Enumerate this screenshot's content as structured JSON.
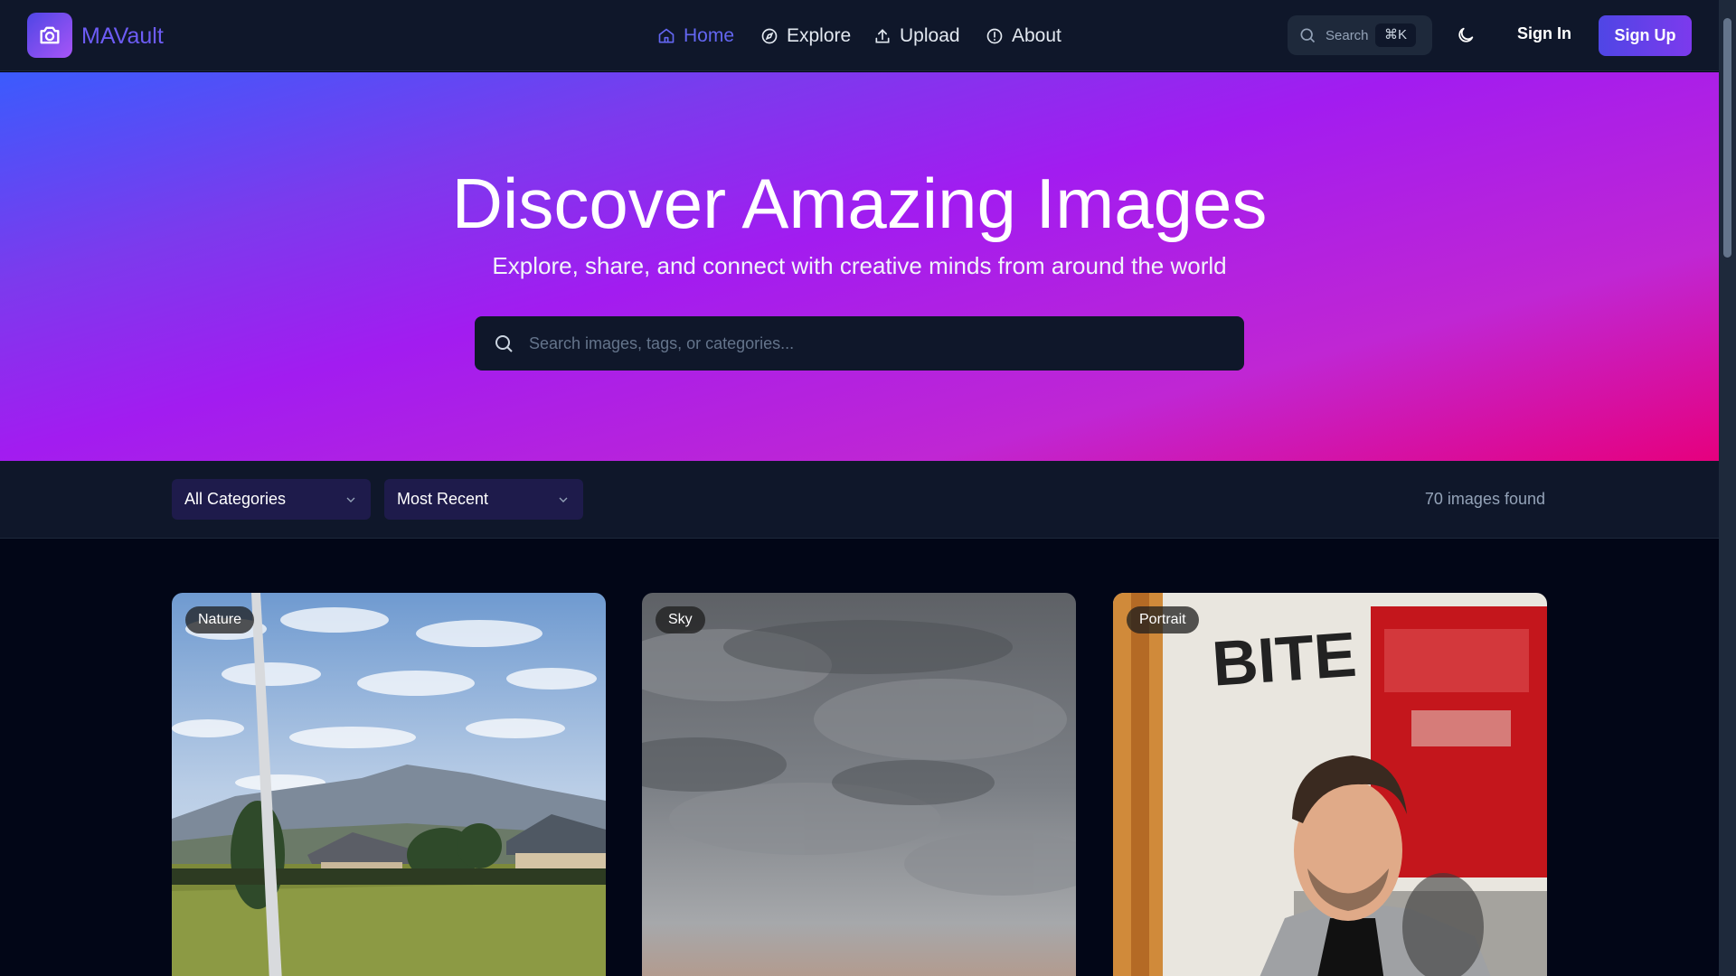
{
  "app": {
    "name": "MAVault"
  },
  "nav": {
    "home": "Home",
    "explore": "Explore",
    "upload": "Upload",
    "about": "About"
  },
  "header_search": {
    "label": "Search",
    "shortcut": "⌘K"
  },
  "auth": {
    "sign_in": "Sign In",
    "sign_up": "Sign Up"
  },
  "hero": {
    "title": "Discover Amazing Images",
    "subtitle": "Explore, share, and connect with creative minds from around the world",
    "search_placeholder": "Search images, tags, or categories..."
  },
  "filters": {
    "category": "All Categories",
    "sort": "Most Recent",
    "result_count": "70 images found"
  },
  "gallery": [
    {
      "category": "Nature"
    },
    {
      "category": "Sky"
    },
    {
      "category": "Portrait"
    }
  ],
  "colors": {
    "accent": "#6366f1",
    "brand_gradient_start": "#4f46e5",
    "brand_gradient_end": "#a855f7",
    "hero_end": "#e6007e"
  }
}
